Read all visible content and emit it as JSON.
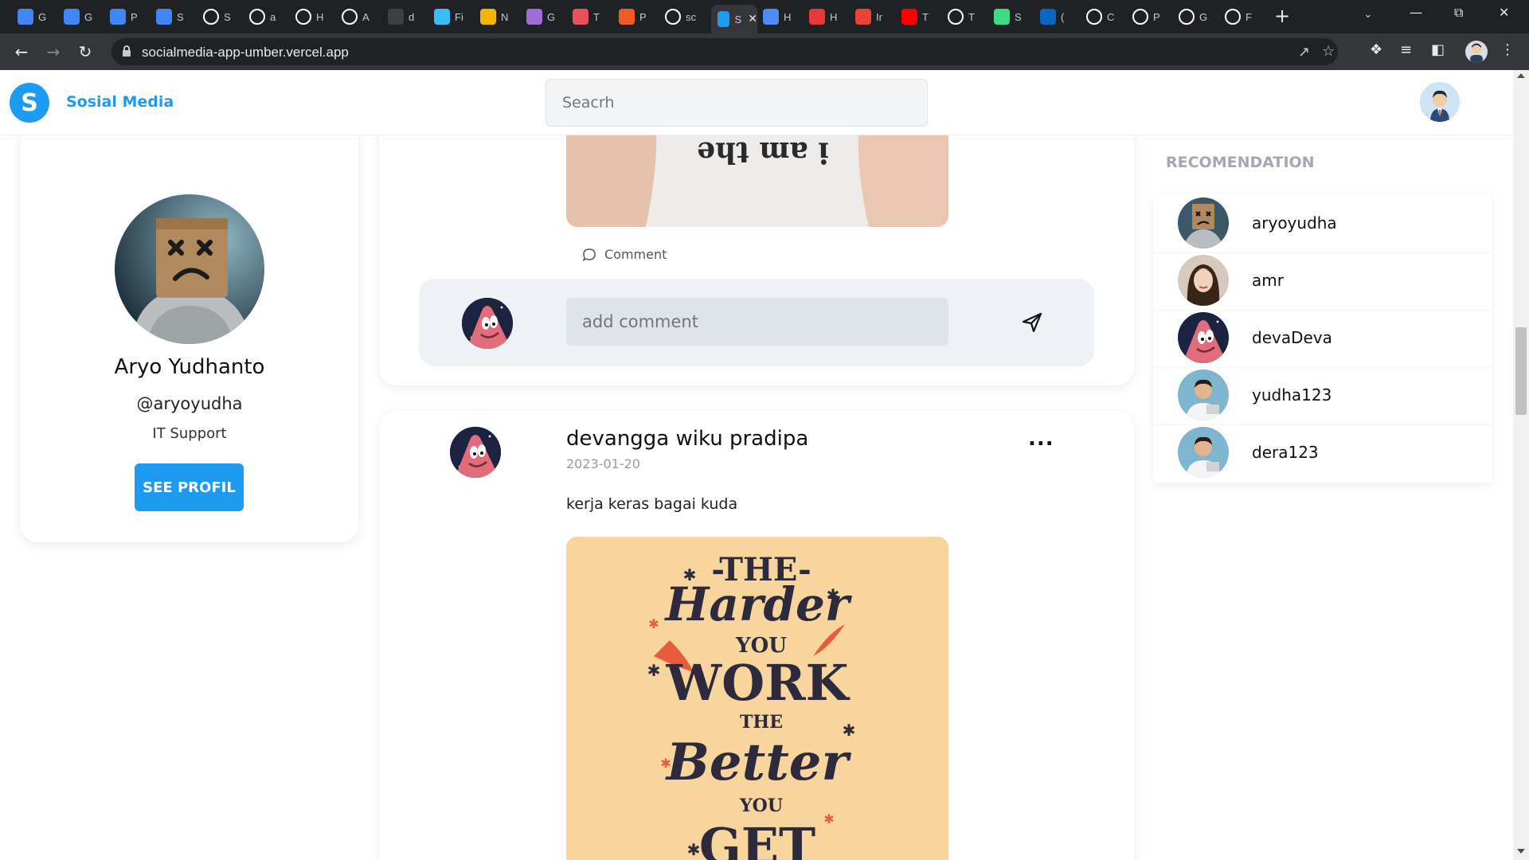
{
  "browser": {
    "tabs": [
      {
        "icon": "google-docs-icon",
        "label": "G",
        "color": "#4285f4"
      },
      {
        "icon": "google-docs-icon",
        "label": "G",
        "color": "#4285f4"
      },
      {
        "icon": "google-docs-icon",
        "label": "P",
        "color": "#4285f4"
      },
      {
        "icon": "google-docs-icon",
        "label": "S",
        "color": "#4285f4"
      },
      {
        "icon": "github-icon",
        "label": "S",
        "color": "#ffffff"
      },
      {
        "icon": "github-icon",
        "label": "a",
        "color": "#ffffff"
      },
      {
        "icon": "github-icon",
        "label": "H",
        "color": "#ffffff"
      },
      {
        "icon": "github-icon",
        "label": "A",
        "color": "#ffffff"
      },
      {
        "icon": "dark-circle-icon",
        "label": "d",
        "color": "#3c4043"
      },
      {
        "icon": "tailwind-icon",
        "label": "Fi",
        "color": "#38bdf8"
      },
      {
        "icon": "sunflower-icon",
        "label": "N",
        "color": "#f4b400"
      },
      {
        "icon": "graphql-icon",
        "label": "G",
        "color": "#a06cd5"
      },
      {
        "icon": "chart-icon",
        "label": "T",
        "color": "#e8505b"
      },
      {
        "icon": "postman-icon",
        "label": "P",
        "color": "#ef5b25"
      },
      {
        "icon": "vercel-icon",
        "label": "sc",
        "color": "#ffffff"
      },
      {
        "icon": "app-s-icon",
        "label": "S",
        "color": "#1d9bf0",
        "active": true
      },
      {
        "icon": "check-icon",
        "label": "H",
        "color": "#4d8cf5"
      },
      {
        "icon": "pokeball-icon",
        "label": "H",
        "color": "#e53935"
      },
      {
        "icon": "gmail-icon",
        "label": "Ir",
        "color": "#ea4335"
      },
      {
        "icon": "youtube-icon",
        "label": "T",
        "color": "#ff0000"
      },
      {
        "icon": "dev-icon",
        "label": "T",
        "color": "#000000"
      },
      {
        "icon": "code-icon",
        "label": "S",
        "color": "#3ddc84"
      },
      {
        "icon": "linkedin-icon",
        "label": "(",
        "color": "#0a66c2"
      },
      {
        "icon": "github-icon",
        "label": "C",
        "color": "#ffffff"
      },
      {
        "icon": "github-icon",
        "label": "P",
        "color": "#ffffff"
      },
      {
        "icon": "github-icon",
        "label": "G",
        "color": "#ffffff"
      },
      {
        "icon": "github-icon",
        "label": "F",
        "color": "#ffffff"
      }
    ],
    "url": "socialmedia-app-umber.vercel.app"
  },
  "header": {
    "logo_letter": "S",
    "brand": "Sosial Media",
    "search_placeholder": "Seacrh"
  },
  "profile": {
    "name": "Aryo Yudhanto",
    "handle": "@aryoyudha",
    "role": "IT Support",
    "button": "SEE PROFIL"
  },
  "feed": {
    "post1": {
      "image_text": "i am the",
      "comment_label": "Comment",
      "comment_placeholder": "add comment"
    },
    "post2": {
      "author": "devangga wiku pradipa",
      "date": "2023-01-20",
      "more": "...",
      "text": "kerja keras bagai kuda",
      "image_lines": [
        "-THE-",
        "Harder",
        "YOU",
        "WORK",
        "THE",
        "Better",
        "YOU",
        "GET"
      ]
    }
  },
  "recommendation": {
    "title": "RECOMENDATION",
    "users": [
      {
        "name": "aryoyudha",
        "avatar": "paperbag"
      },
      {
        "name": "amr",
        "avatar": "woman"
      },
      {
        "name": "devaDeva",
        "avatar": "patrick"
      },
      {
        "name": "yudha123",
        "avatar": "man"
      },
      {
        "name": "dera123",
        "avatar": "man"
      }
    ]
  }
}
